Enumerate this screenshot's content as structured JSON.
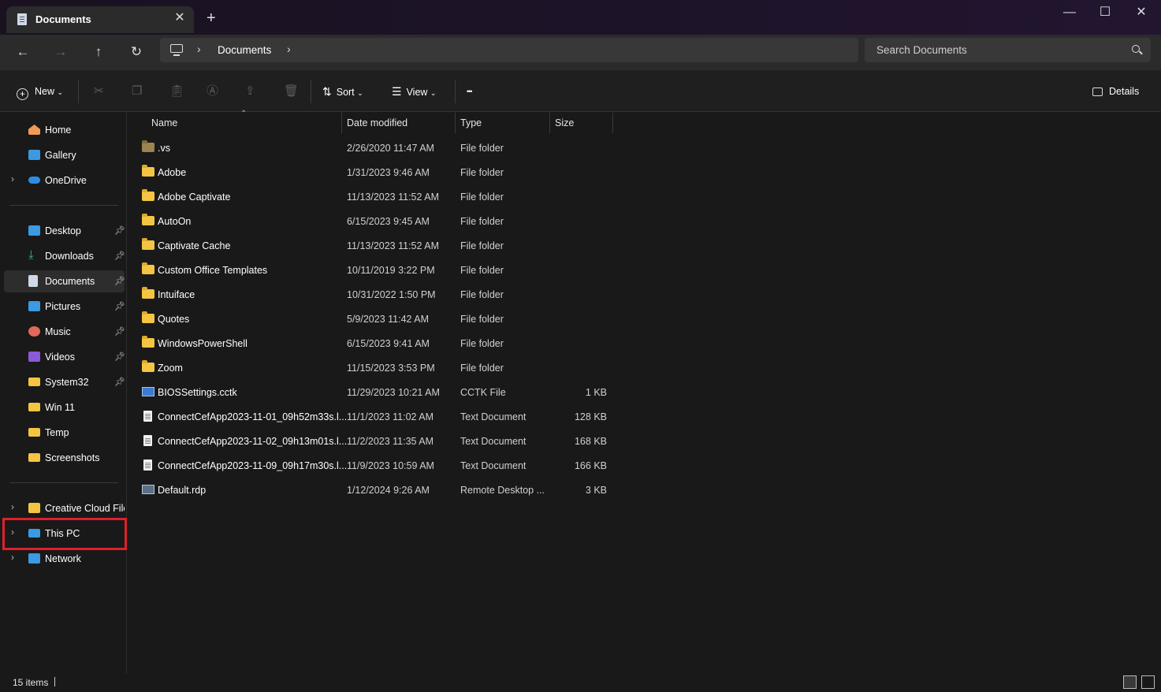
{
  "window": {
    "tab_title": "Documents",
    "tab_close": "✕",
    "new_tab": "+",
    "minimize": "—",
    "maximize": "☐",
    "close": "✕"
  },
  "address": {
    "crumb": "Documents",
    "search_placeholder": "Search Documents"
  },
  "toolbar": {
    "new_label": "New",
    "sort_label": "Sort",
    "view_label": "View",
    "more_label": "•••",
    "details_label": "Details"
  },
  "sidebar": {
    "top": [
      {
        "label": "Home",
        "icon": "home-icon",
        "color": "#f09a5a"
      },
      {
        "label": "Gallery",
        "icon": "gallery-icon",
        "color": "#3b9ae1"
      },
      {
        "label": "OneDrive",
        "icon": "onedrive-icon",
        "color": "#2d8ee0"
      }
    ],
    "quick_access": [
      {
        "label": "Desktop",
        "icon": "desktop-icon",
        "color": "#3b9ae1",
        "pinned": true
      },
      {
        "label": "Downloads",
        "icon": "downloads-icon",
        "color": "#3fbf7a",
        "pinned": true
      },
      {
        "label": "Documents",
        "icon": "documents-icon",
        "color": "#cfd8e6",
        "pinned": true,
        "selected": true
      },
      {
        "label": "Pictures",
        "icon": "pictures-icon",
        "color": "#3b9ae1",
        "pinned": true
      },
      {
        "label": "Music",
        "icon": "music-icon",
        "color": "#e06a5a",
        "pinned": true
      },
      {
        "label": "Videos",
        "icon": "videos-icon",
        "color": "#8a5bd6",
        "pinned": true
      },
      {
        "label": "System32",
        "icon": "folder-icon",
        "color": "#f4c542",
        "pinned": true
      },
      {
        "label": "Win 11",
        "icon": "folder-icon",
        "color": "#f4c542",
        "pinned": false
      },
      {
        "label": "Temp",
        "icon": "folder-icon",
        "color": "#f4c542",
        "pinned": false
      },
      {
        "label": "Screenshots",
        "icon": "folder-icon",
        "color": "#f4c542",
        "pinned": false
      }
    ],
    "locations": [
      {
        "label": "Creative Cloud Files",
        "icon": "creative-cloud-icon",
        "color": "#f4c542"
      },
      {
        "label": "This PC",
        "icon": "this-pc-icon",
        "color": "#3b9ae1"
      },
      {
        "label": "Network",
        "icon": "network-icon",
        "color": "#3b9ae1"
      }
    ]
  },
  "columns": {
    "name": "Name",
    "date": "Date modified",
    "type": "Type",
    "size": "Size"
  },
  "files": [
    {
      "name": ".vs",
      "date": "2/26/2020 11:47 AM",
      "type": "File folder",
      "size": "",
      "kind": "folder-dark"
    },
    {
      "name": "Adobe",
      "date": "1/31/2023 9:46 AM",
      "type": "File folder",
      "size": "",
      "kind": "folder"
    },
    {
      "name": "Adobe Captivate",
      "date": "11/13/2023 11:52 AM",
      "type": "File folder",
      "size": "",
      "kind": "folder"
    },
    {
      "name": "AutoOn",
      "date": "6/15/2023 9:45 AM",
      "type": "File folder",
      "size": "",
      "kind": "folder"
    },
    {
      "name": "Captivate Cache",
      "date": "11/13/2023 11:52 AM",
      "type": "File folder",
      "size": "",
      "kind": "folder"
    },
    {
      "name": "Custom Office Templates",
      "date": "10/11/2019 3:22 PM",
      "type": "File folder",
      "size": "",
      "kind": "folder"
    },
    {
      "name": "Intuiface",
      "date": "10/31/2022 1:50 PM",
      "type": "File folder",
      "size": "",
      "kind": "folder"
    },
    {
      "name": "Quotes",
      "date": "5/9/2023 11:42 AM",
      "type": "File folder",
      "size": "",
      "kind": "folder"
    },
    {
      "name": "WindowsPowerShell",
      "date": "6/15/2023 9:41 AM",
      "type": "File folder",
      "size": "",
      "kind": "folder"
    },
    {
      "name": "Zoom",
      "date": "11/15/2023 3:53 PM",
      "type": "File folder",
      "size": "",
      "kind": "folder"
    },
    {
      "name": "BIOSSettings.cctk",
      "date": "11/29/2023 10:21 AM",
      "type": "CCTK File",
      "size": "1 KB",
      "kind": "cctk"
    },
    {
      "name": "ConnectCefApp2023-11-01_09h52m33s.l...",
      "date": "11/1/2023 11:02 AM",
      "type": "Text Document",
      "size": "128 KB",
      "kind": "doc"
    },
    {
      "name": "ConnectCefApp2023-11-02_09h13m01s.l...",
      "date": "11/2/2023 11:35 AM",
      "type": "Text Document",
      "size": "168 KB",
      "kind": "doc"
    },
    {
      "name": "ConnectCefApp2023-11-09_09h17m30s.l...",
      "date": "11/9/2023 10:59 AM",
      "type": "Text Document",
      "size": "166 KB",
      "kind": "doc"
    },
    {
      "name": "Default.rdp",
      "date": "1/12/2024 9:26 AM",
      "type": "Remote Desktop ...",
      "size": "3 KB",
      "kind": "rdp"
    }
  ],
  "status": {
    "count": "15 items"
  }
}
